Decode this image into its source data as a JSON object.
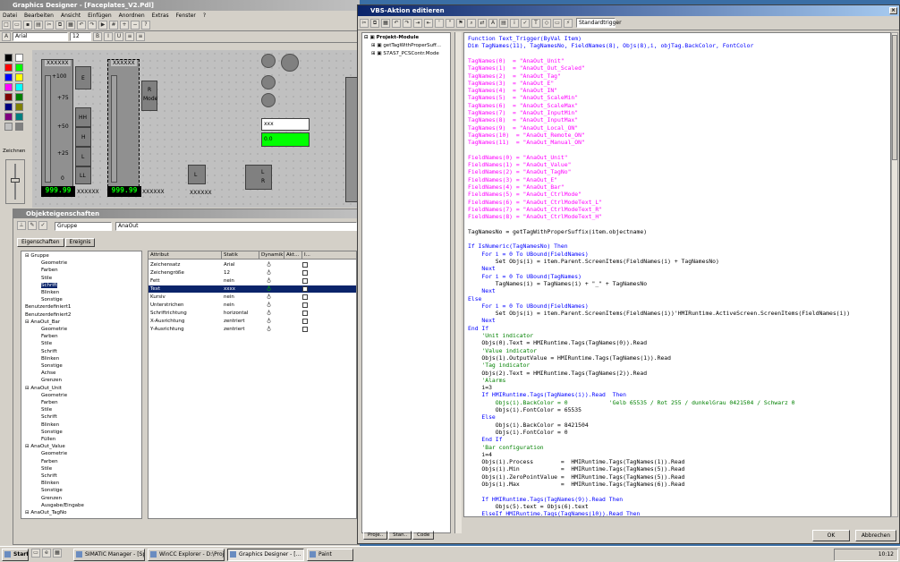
{
  "gd": {
    "title": "Graphics Designer - [Faceplates_V2.Pdl]",
    "menu": [
      "Datei",
      "Bearbeiten",
      "Ansicht",
      "Einfügen",
      "Anordnen",
      "Extras",
      "Fenster",
      "?"
    ],
    "font_name": "Arial",
    "font_size": "12",
    "zoom_label": "Zeichnen"
  },
  "faceplate": {
    "tag1": "XXXXXX",
    "tag2": "XXXXXX",
    "tag3": "XXXXXX",
    "tag4": "XXXXXX",
    "tag5": "XXXXXX",
    "s100": "+100",
    "s75": "+75",
    "s50": "+50",
    "s25": "+25",
    "s0": "0",
    "btn_e": "E",
    "btn_hh": "HH",
    "btn_h": "H",
    "btn_l": "L",
    "btn_ll": "LL",
    "btn_r": "R",
    "btn_mode": "Mode",
    "btn_l2": "L",
    "btn_l3": "L",
    "btn_r2": "R",
    "val1": "999.99",
    "val2": "999.99",
    "xxx_field": "xxx",
    "green_field": "0.0"
  },
  "op": {
    "title": "Objekteigenschaften",
    "type_label": "Gruppe",
    "object_name": "AnaOut",
    "tabs": [
      "Eigenschaften",
      "Ereignis"
    ],
    "tree": [
      "Gruppe",
      "Geometrie",
      "Farben",
      "Stile",
      "Schrift",
      "Blinken",
      "Sonstige",
      "Benutzerdefiniert1",
      "Benutzerdefiniert2",
      "AnaOut_Bar",
      "Geometrie",
      "Farben",
      "Stile",
      "Schrift",
      "Blinken",
      "Sonstige",
      "Achse",
      "Grenzen",
      "AnaOut_Unit",
      "Geometrie",
      "Farben",
      "Stile",
      "Schrift",
      "Blinken",
      "Sonstige",
      "Füllen",
      "AnaOut_Value",
      "Geometrie",
      "Farben",
      "Stile",
      "Schrift",
      "Blinken",
      "Sonstige",
      "Grenzen",
      "Ausgabe/Eingabe",
      "AnaOut_TagNo"
    ],
    "headers": [
      "Attribut",
      "Statik",
      "Dynamik",
      "Akt...",
      "I..."
    ],
    "rows": [
      {
        "a": "Zeichensatz",
        "s": "Arial"
      },
      {
        "a": "Zeichengröße",
        "s": "12"
      },
      {
        "a": "Fett",
        "s": "nein"
      },
      {
        "a": "Text",
        "s": "xxxx"
      },
      {
        "a": "Kursiv",
        "s": "nein"
      },
      {
        "a": "Unterstrichen",
        "s": "nein"
      },
      {
        "a": "Schriftrichtung",
        "s": "horizontal"
      },
      {
        "a": "X-Ausrichtung",
        "s": "zentriert"
      },
      {
        "a": "Y-Ausrichtung",
        "s": "zentriert"
      }
    ]
  },
  "vbs": {
    "title": "VBS-Aktion editieren",
    "trigger": "Standardtrigger",
    "tree": [
      "Projekt-Module",
      "getTagWithProperSuff...",
      "S7AS7_PCSContr.Mode"
    ],
    "tabs": [
      "Proje..",
      "Stan..",
      "Code"
    ],
    "ok": "OK",
    "cancel": "Abbrechen",
    "code": [
      {
        "t": "Function Text_Trigger(ByVal Item)",
        "c": "kw"
      },
      {
        "t": "Dim TagNames(11), TagNamesNo, FieldNames(8), Objs(8),i, objTag.BackColor, FontColor",
        "c": "kw"
      },
      {
        "t": "",
        "c": ""
      },
      {
        "t": "TagNames(0)  = \"AnaOut_Unit\"",
        "c": "str"
      },
      {
        "t": "TagNames(1)  = \"AnaOut_Out_Scaled\"",
        "c": "str"
      },
      {
        "t": "TagNames(2)  = \"AnaOut_Tag\"",
        "c": "str"
      },
      {
        "t": "TagNames(3)  = \"AnaOut_E\"",
        "c": "str"
      },
      {
        "t": "TagNames(4)  = \"AnaOut_IN\"",
        "c": "str"
      },
      {
        "t": "TagNames(5)  = \"AnaOut_ScaleMin\"",
        "c": "str"
      },
      {
        "t": "TagNames(6)  = \"AnaOut_ScaleMax\"",
        "c": "str"
      },
      {
        "t": "TagNames(7)  = \"AnaOut_InputMin\"",
        "c": "str"
      },
      {
        "t": "TagNames(8)  = \"AnaOut_InputMax\"",
        "c": "str"
      },
      {
        "t": "TagNames(9)  = \"AnaOut_Local_ON\"",
        "c": "str"
      },
      {
        "t": "TagNames(10)  = \"AnaOut_Remote_ON\"",
        "c": "str"
      },
      {
        "t": "TagNames(11)  = \"AnaOut_Manual_ON\"",
        "c": "str"
      },
      {
        "t": "",
        "c": ""
      },
      {
        "t": "FieldNames(0) = \"AnaOut_Unit\"",
        "c": "str"
      },
      {
        "t": "FieldNames(1) = \"AnaOut_Value\"",
        "c": "str"
      },
      {
        "t": "FieldNames(2) = \"AnaOut_TagNo\"",
        "c": "str"
      },
      {
        "t": "FieldNames(3) = \"AnaOut_E\"",
        "c": "str"
      },
      {
        "t": "FieldNames(4) = \"AnaOut_Bar\"",
        "c": "str"
      },
      {
        "t": "FieldNames(5) = \"AnaOut_CtrlMode\"",
        "c": "str"
      },
      {
        "t": "FieldNames(6) = \"AnaOut_CtrlModeText_L\"",
        "c": "str"
      },
      {
        "t": "FieldNames(7) = \"AnaOut_CtrlModeText_R\"",
        "c": "str"
      },
      {
        "t": "FieldNames(8) = \"AnaOut_CtrlModeText_H\"",
        "c": "str"
      },
      {
        "t": "",
        "c": ""
      },
      {
        "t": "TagNamesNo = getTagWithProperSuffix(item.objectname)",
        "c": ""
      },
      {
        "t": "",
        "c": ""
      },
      {
        "t": "If IsNumeric(TagNamesNo) Then",
        "c": "kw"
      },
      {
        "t": "    For i = 0 To UBound(FieldNames)",
        "c": "kw"
      },
      {
        "t": "        Set Objs(i) = item.Parent.ScreenItems(FieldNames(i) + TagNamesNo)",
        "c": ""
      },
      {
        "t": "    Next",
        "c": "kw"
      },
      {
        "t": "    For i = 0 To UBound(TagNames)",
        "c": "kw"
      },
      {
        "t": "        TagNames(i) = TagNames(i) + \"_\" + TagNamesNo",
        "c": ""
      },
      {
        "t": "    Next",
        "c": "kw"
      },
      {
        "t": "Else",
        "c": "kw"
      },
      {
        "t": "    For i = 0 To UBound(FieldNames)",
        "c": "kw"
      },
      {
        "t": "        Set Objs(i) = item.Parent.ScreenItems(FieldNames(i))'HMIRuntime.ActiveScreen.ScreenItems(FieldNames(i))",
        "c": ""
      },
      {
        "t": "    Next",
        "c": "kw"
      },
      {
        "t": "End If",
        "c": "kw"
      },
      {
        "t": "    'Unit indicator",
        "c": "cmt"
      },
      {
        "t": "    Objs(0).Text = HMIRuntime.Tags(TagNames(0)).Read",
        "c": ""
      },
      {
        "t": "    'Value indicator",
        "c": "cmt"
      },
      {
        "t": "    Objs(1).OutputValue = HMIRuntime.Tags(TagNames(1)).Read",
        "c": ""
      },
      {
        "t": "    'Tag indicator",
        "c": "cmt"
      },
      {
        "t": "    Objs(2).Text = HMIRuntime.Tags(TagNames(2)).Read",
        "c": ""
      },
      {
        "t": "    'Alarms",
        "c": "cmt"
      },
      {
        "t": "    i=3",
        "c": ""
      },
      {
        "t": "    If HMIRuntime.Tags(TagNames(i)).Read  Then",
        "c": "kw"
      },
      {
        "t": "        Objs(i).BackColor = 0            'Gelb 65535 / Rot 255 / dunkelGrau 0421504 / Schwarz 0",
        "c": "cmt"
      },
      {
        "t": "        Objs(i).FontColor = 65535",
        "c": ""
      },
      {
        "t": "    Else",
        "c": "kw"
      },
      {
        "t": "        Objs(i).BackColor = 8421504",
        "c": ""
      },
      {
        "t": "        Objs(i).FontColor = 0",
        "c": ""
      },
      {
        "t": "    End If",
        "c": "kw"
      },
      {
        "t": "    'Bar configuration",
        "c": "cmt"
      },
      {
        "t": "    i=4",
        "c": ""
      },
      {
        "t": "    Objs(i).Process        =  HMIRuntime.Tags(TagNames(1)).Read",
        "c": ""
      },
      {
        "t": "    Objs(i).Min            =  HMIRuntime.Tags(TagNames(5)).Read",
        "c": ""
      },
      {
        "t": "    Objs(i).ZeroPointValue =  HMIRuntime.Tags(TagNames(5)).Read",
        "c": ""
      },
      {
        "t": "    Objs(i).Max            =  HMIRuntime.Tags(TagNames(6)).Read",
        "c": ""
      },
      {
        "t": "",
        "c": ""
      },
      {
        "t": "    If HMIRuntime.Tags(TagNames(9)).Read Then",
        "c": "kw"
      },
      {
        "t": "        Objs(5).text = Objs(6).text",
        "c": ""
      },
      {
        "t": "    ElseIf HMIRuntime.Tags(TagNames(10)).Read Then",
        "c": "kw"
      }
    ]
  },
  "taskbar": {
    "start": "Start",
    "tasks": [
      "SIMATIC Manager - [Sp...",
      "WinCC Explorer - D:\\Proj...",
      "Graphics Designer - [...",
      "Paint"
    ],
    "clock": "10:12"
  },
  "colors": {
    "swatches": [
      "#000000",
      "#ffffff",
      "#ff0000",
      "#00ff00",
      "#0000ff",
      "#ffff00",
      "#ff00ff",
      "#00ffff",
      "#800000",
      "#008000",
      "#000080",
      "#808000",
      "#800080",
      "#008080",
      "#c0c0c0",
      "#808080"
    ]
  }
}
